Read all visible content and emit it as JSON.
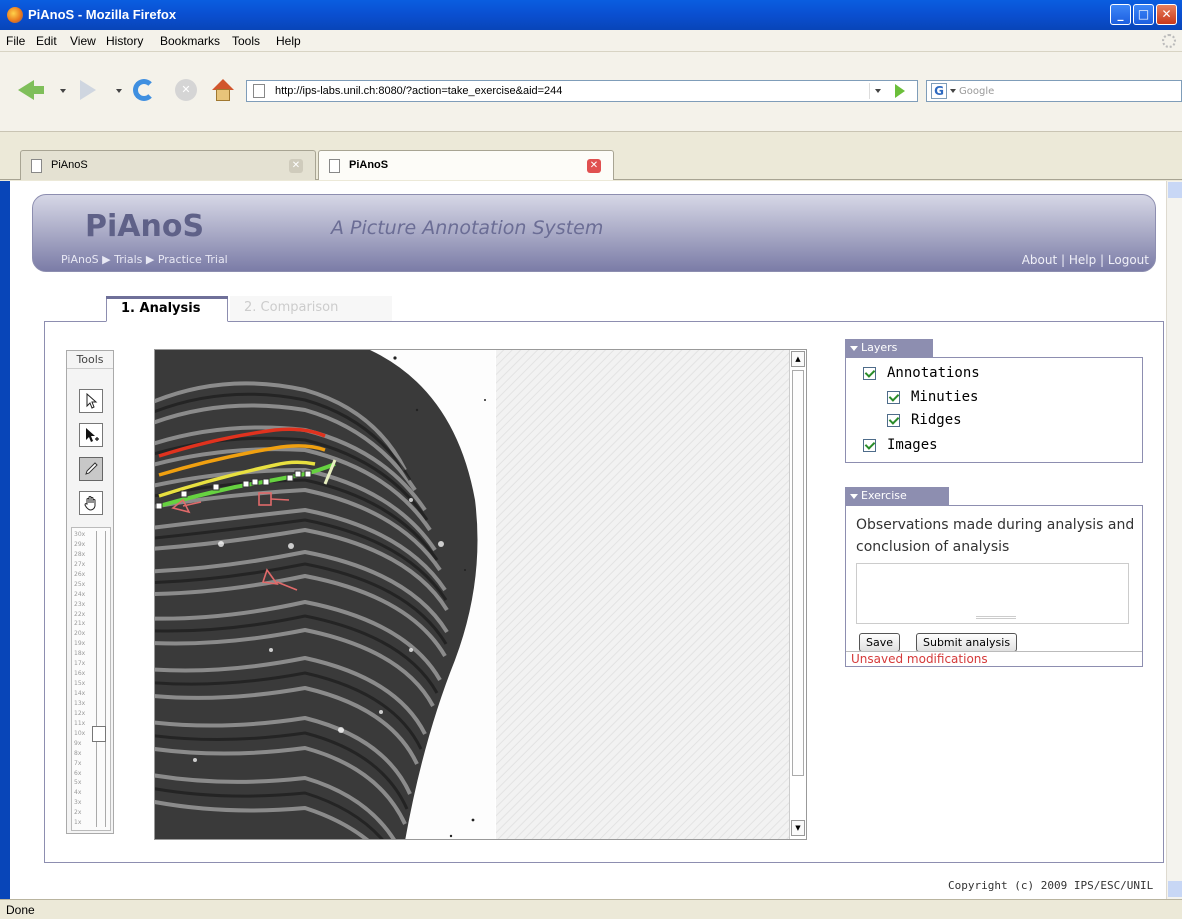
{
  "window": {
    "title": "PiAnoS - Mozilla Firefox"
  },
  "menu": [
    "File",
    "Edit",
    "View",
    "History",
    "Bookmarks",
    "Tools",
    "Help"
  ],
  "navbar": {
    "url": "http://ips-labs.unil.ch:8080/?action=take_exercise&aid=244",
    "search_placeholder": "Google"
  },
  "browser_tabs": [
    {
      "label": "PiAnoS",
      "active": false
    },
    {
      "label": "PiAnoS",
      "active": true
    }
  ],
  "app": {
    "brand": "PiAnoS",
    "tagline": "A Picture Annotation System",
    "breadcrumb": [
      "PiAnoS",
      "Trials",
      "Practice Trial"
    ],
    "top_links": [
      "About",
      "Help",
      "Logout"
    ],
    "tabs": [
      {
        "label": "1. Analysis",
        "active": true
      },
      {
        "label": "2. Comparison",
        "active": false
      }
    ],
    "tools": {
      "title": "Tools",
      "buttons": [
        "pointer-icon",
        "add-point-icon",
        "pencil-icon",
        "hand-icon"
      ],
      "zoom_levels": [
        "30x",
        "29x",
        "28x",
        "27x",
        "26x",
        "25x",
        "24x",
        "23x",
        "22x",
        "21x",
        "20x",
        "19x",
        "18x",
        "17x",
        "16x",
        "15x",
        "14x",
        "13x",
        "12x",
        "11x",
        "10x",
        "9x",
        "8x",
        "7x",
        "6x",
        "5x",
        "4x",
        "3x",
        "2x",
        "1x"
      ],
      "zoom_current": "10x"
    },
    "layers": {
      "title": "Layers",
      "items": [
        {
          "label": "Annotations",
          "checked": true
        },
        {
          "label": "Minuties",
          "checked": true
        },
        {
          "label": "Ridges",
          "checked": true
        },
        {
          "label": "Images",
          "checked": true
        }
      ]
    },
    "exercise": {
      "title": "Exercise",
      "prompt": "Observations made during analysis and conclusion of analysis",
      "textarea_value": "",
      "save_label": "Save",
      "submit_label": "Submit analysis",
      "status": "Unsaved modifications"
    },
    "annotation_colors": {
      "ridge_red": "#e0321e",
      "ridge_orange": "#f0a010",
      "ridge_yellow": "#e8e040",
      "ridge_green": "#66d240",
      "minutia": "#e06a6a"
    },
    "copyright": "Copyright (c) 2009 IPS/ESC/UNIL"
  },
  "status_bar": "Done"
}
